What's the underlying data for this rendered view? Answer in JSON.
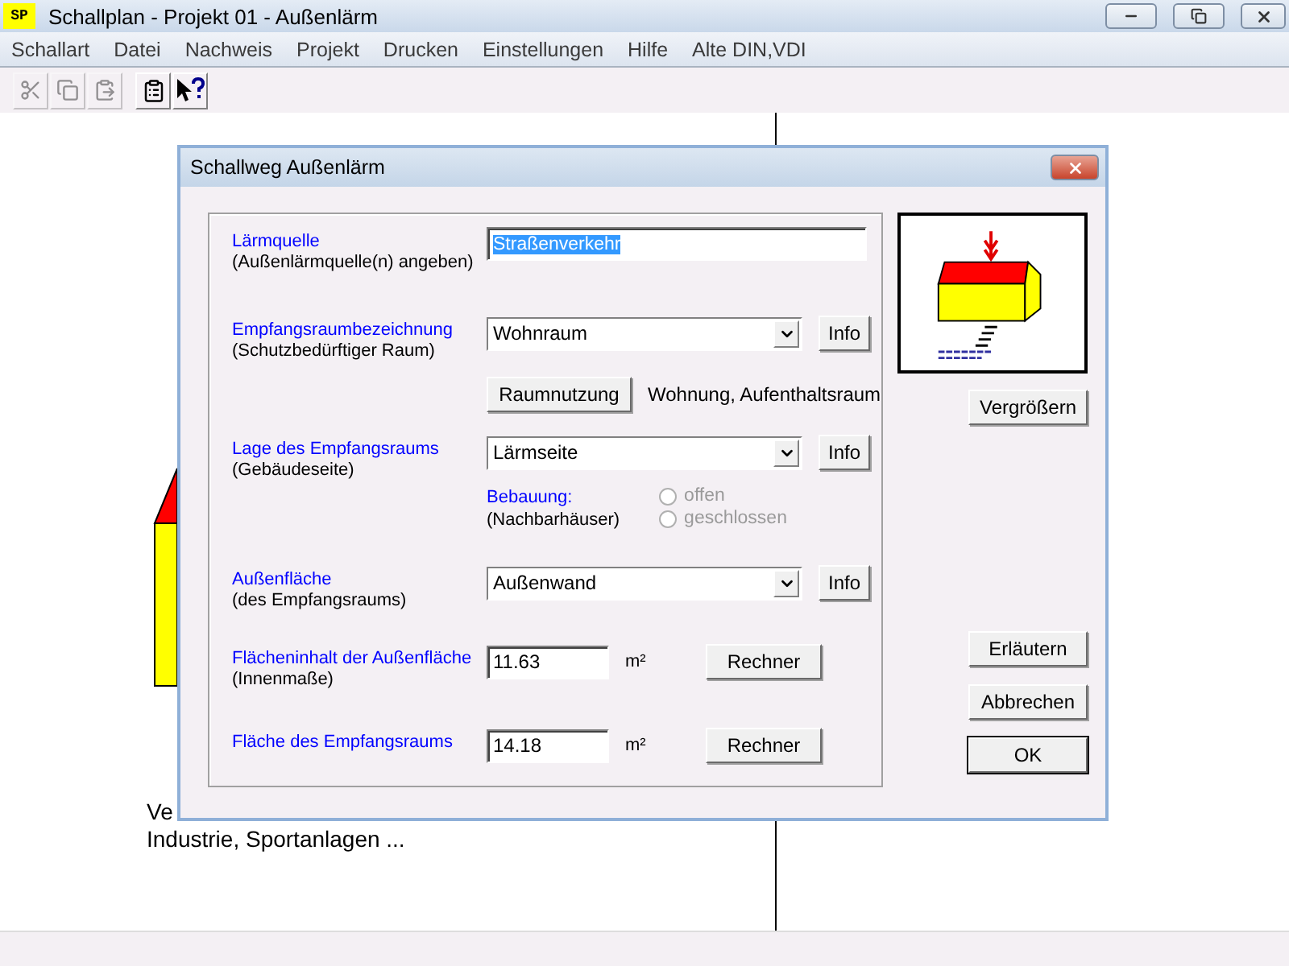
{
  "window": {
    "logo": "SP",
    "title": "Schallplan  - Projekt 01 - Außenlärm"
  },
  "menu": [
    "Schallart",
    "Datei",
    "Nachweis",
    "Projekt",
    "Drucken",
    "Einstellungen",
    "Hilfe",
    "Alte DIN,VDI"
  ],
  "toolbar": [
    {
      "kind": "cut",
      "disabled": true
    },
    {
      "kind": "copy",
      "disabled": true
    },
    {
      "kind": "paste",
      "disabled": true
    },
    {
      "kind": "properties",
      "disabled": false
    },
    {
      "kind": "help",
      "disabled": false
    }
  ],
  "canvas": {
    "lines": [
      "Ve",
      "Industrie, Sportanlagen ..."
    ]
  },
  "dialog": {
    "title": "Schallweg Außenlärm",
    "rows": [
      {
        "kind": "text",
        "label": "Lärmquelle",
        "hint": "(Außenlärmquelle(n) angeben)",
        "value": "Straßenverkehr",
        "value_selected": true
      },
      {
        "kind": "select",
        "label": "Empfangsraumbezeichnung",
        "hint": "(Schutzbedürftiger Raum)",
        "value": "Wohnraum",
        "button": "Info"
      },
      {
        "kind": "action",
        "button": "Raumnutzung",
        "note": "Wohnung, Aufenthaltsraum"
      },
      {
        "kind": "select",
        "label": "Lage des Empfangsraums",
        "hint": "(Gebäudeseite)",
        "value": "Lärmseite",
        "button": "Info"
      },
      {
        "kind": "radio",
        "label": "Bebauung:",
        "hint": "(Nachbarhäuser)",
        "options": [
          {
            "label": "offen",
            "selected": false,
            "disabled": true
          },
          {
            "label": "geschlossen",
            "selected": false,
            "disabled": true
          }
        ]
      },
      {
        "kind": "select",
        "label": "Außenfläche",
        "hint": "(des Empfangsraums)",
        "value": "Außenwand",
        "button": "Info"
      },
      {
        "kind": "number",
        "label": "Flächeninhalt der Außenfläche",
        "hint": "(Innenmaße)",
        "value": "11.63",
        "unit": "m²",
        "button": "Rechner"
      },
      {
        "kind": "number",
        "label": "Fläche des Empfangsraums",
        "value": "14.18",
        "unit": "m²",
        "button": "Rechner"
      }
    ],
    "preview_button": "Vergrößern",
    "buttons": [
      {
        "label": "Erläutern",
        "default": false
      },
      {
        "label": "Abbrechen",
        "default": false
      },
      {
        "label": "OK",
        "default": true
      }
    ]
  }
}
